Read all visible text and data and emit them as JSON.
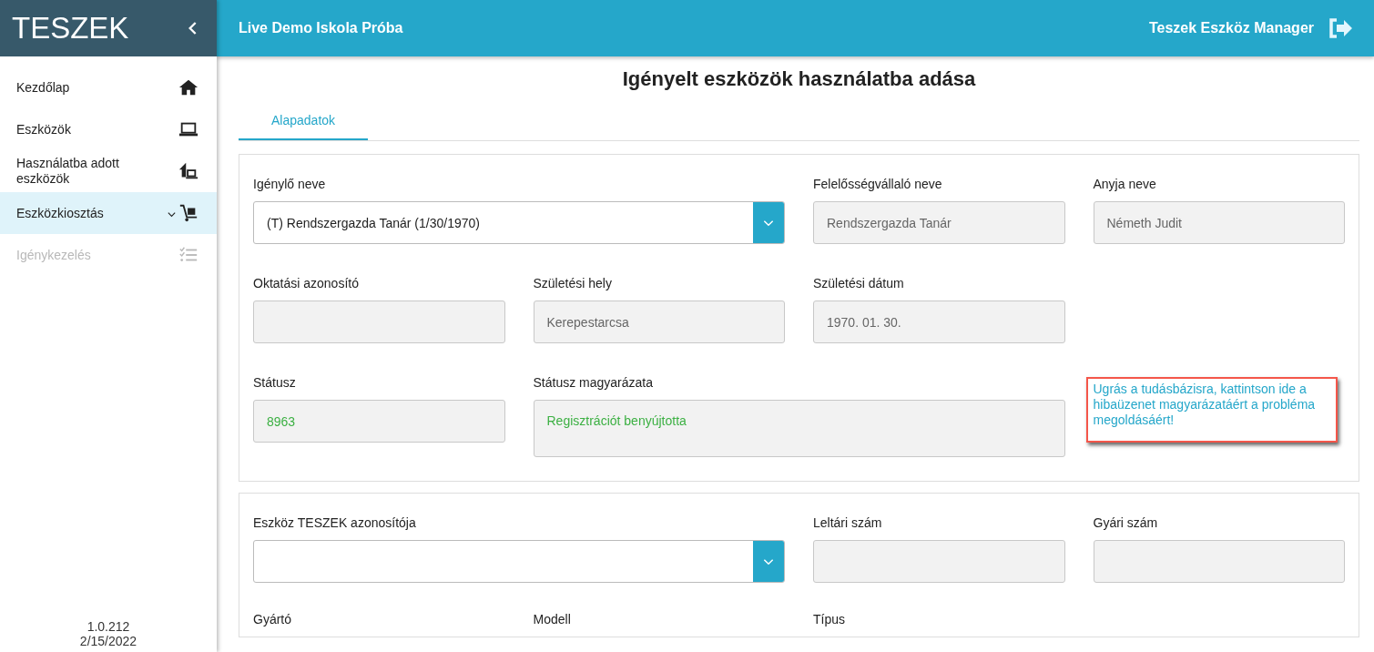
{
  "sidebar": {
    "logo": "TESZEK",
    "items": [
      {
        "label": "Kezdőlap",
        "selected": false,
        "disabled": false,
        "expandable": false
      },
      {
        "label": "Eszközök",
        "selected": false,
        "disabled": false,
        "expandable": false
      },
      {
        "label": "Használatba adott eszközök",
        "selected": false,
        "disabled": false,
        "expandable": false
      },
      {
        "label": "Eszközkiosztás",
        "selected": true,
        "disabled": false,
        "expandable": true
      },
      {
        "label": "Igénykezelés",
        "selected": false,
        "disabled": true,
        "expandable": false
      }
    ],
    "version": "1.0.212",
    "date": "2/15/2022"
  },
  "topbar": {
    "school": "Live Demo Iskola Próba",
    "app_name": "Teszek Eszköz Manager"
  },
  "page_title": "Igényelt eszközök használatba adása",
  "tabs": [
    {
      "label": "Alapadatok",
      "selected": true
    }
  ],
  "sections": [
    {
      "rows": [
        [
          {
            "kind": "select",
            "label": "Igénylő neve",
            "value": "(T) Rendszergazda Tanár (1/30/1970)"
          },
          "",
          {
            "kind": "text",
            "label": "Felelősségvállaló neve",
            "value": "Rendszergazda Tanár"
          },
          {
            "kind": "text",
            "label": "Anyja neve",
            "value": "Németh Judit"
          }
        ],
        [
          {
            "kind": "text",
            "label": "Oktatási azonosító"
          },
          {
            "kind": "text",
            "label": "Születési hely",
            "value": "Kerepestarcsa"
          },
          {
            "kind": "text",
            "label": "Születési dátum",
            "value": "1970. 01. 30."
          }
        ],
        [
          {
            "kind": "text",
            "label": "Státusz",
            "value": "8963",
            "highlighted": true
          },
          {
            "kind": "textarea",
            "label": "Státusz magyarázata",
            "value": "Regisztrációt benyújtotta",
            "highlighted": true
          },
          "",
          {
            "kind": "link",
            "text": "Ugrás a tudásbázisra, kattintson ide a hibaüzenet magyarázatáért a probléma megoldásáért!"
          }
        ]
      ]
    },
    {
      "rows": [
        [
          {
            "kind": "select",
            "label": "Eszköz TESZEK azonosítója"
          },
          "",
          {
            "kind": "text",
            "label": "Leltári szám"
          },
          {
            "kind": "text",
            "label": "Gyári szám"
          }
        ],
        [
          {
            "kind": "label",
            "label": "Gyártó"
          },
          {
            "kind": "label",
            "label": "Modell"
          },
          {
            "kind": "label",
            "label": "Típus"
          }
        ]
      ]
    }
  ]
}
